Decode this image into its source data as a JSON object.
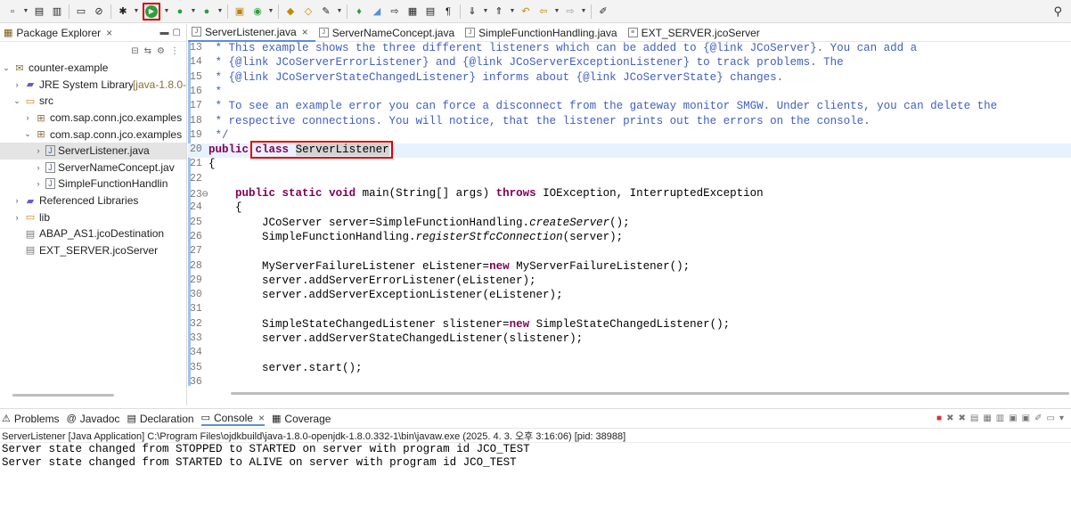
{
  "toolbar": {
    "icons": [
      "new-icon",
      "save-icon",
      "save-all-icon",
      "terminal-icon",
      "skip-breakpoints-icon",
      "debug-icon",
      "run-icon",
      "coverage-icon",
      "external-tools-icon",
      "new-java-project-icon",
      "new-package-icon",
      "new-class-icon",
      "open-type-icon",
      "search-icon",
      "annotation-icon",
      "next-annotation-icon",
      "prev-annotation-icon",
      "back-icon",
      "forward-icon",
      "pin-editor-icon"
    ],
    "highlight_color": "#d00000"
  },
  "package_explorer": {
    "title": "Package Explorer",
    "close": "×",
    "tree": [
      {
        "indent": 0,
        "twisty": "v",
        "icon": "project-icon",
        "label": "counter-example",
        "decor": ""
      },
      {
        "indent": 1,
        "twisty": ">",
        "icon": "library-icon",
        "label": "JRE System Library ",
        "decor": "[java-1.8.0-"
      },
      {
        "indent": 1,
        "twisty": "v",
        "icon": "source-folder-icon",
        "label": "src",
        "decor": ""
      },
      {
        "indent": 2,
        "twisty": ">",
        "icon": "package-icon",
        "label": "com.sap.conn.jco.examples",
        "decor": ""
      },
      {
        "indent": 2,
        "twisty": "v",
        "icon": "package-icon",
        "label": "com.sap.conn.jco.examples",
        "decor": ""
      },
      {
        "indent": 3,
        "twisty": ">",
        "icon": "java-file-icon",
        "label": "ServerListener.java",
        "decor": "",
        "selected": true
      },
      {
        "indent": 3,
        "twisty": ">",
        "icon": "java-file-icon",
        "label": "ServerNameConcept.jav",
        "decor": ""
      },
      {
        "indent": 3,
        "twisty": ">",
        "icon": "java-file-icon",
        "label": "SimpleFunctionHandlin",
        "decor": ""
      },
      {
        "indent": 1,
        "twisty": ">",
        "icon": "library-icon",
        "label": "Referenced Libraries",
        "decor": ""
      },
      {
        "indent": 1,
        "twisty": ">",
        "icon": "folder-icon",
        "label": "lib",
        "decor": ""
      },
      {
        "indent": 1,
        "twisty": "",
        "icon": "file-icon",
        "label": "ABAP_AS1.jcoDestination",
        "decor": ""
      },
      {
        "indent": 1,
        "twisty": "",
        "icon": "file-icon",
        "label": "EXT_SERVER.jcoServer",
        "decor": ""
      }
    ]
  },
  "editor": {
    "tabs": [
      {
        "label": "ServerListener.java",
        "active": true,
        "closable": true,
        "icon": "J"
      },
      {
        "label": "ServerNameConcept.java",
        "active": false,
        "closable": false,
        "icon": "J"
      },
      {
        "label": "SimpleFunctionHandling.java",
        "active": false,
        "closable": false,
        "icon": "J"
      },
      {
        "label": "EXT_SERVER.jcoServer",
        "active": false,
        "closable": false,
        "icon": "≡"
      }
    ],
    "highlight_color": "#e00000",
    "current_line": 20,
    "lines": [
      {
        "n": "13",
        "tokens": [
          {
            "t": " * This example shows the three different listeners which can be added to {@link JCoServer}. You can add a",
            "c": "c"
          }
        ]
      },
      {
        "n": "14",
        "tokens": [
          {
            "t": " * {@link JCoServerErrorListener} and {@link JCoServerExceptionListener} to track problems. The",
            "c": "c"
          }
        ]
      },
      {
        "n": "15",
        "tokens": [
          {
            "t": " * {@link JCoServerStateChangedListener} informs about {@link JCoServerState} changes.",
            "c": "c"
          }
        ]
      },
      {
        "n": "16",
        "tokens": [
          {
            "t": " *",
            "c": "c"
          }
        ]
      },
      {
        "n": "17",
        "tokens": [
          {
            "t": " * To see an example error you can force a disconnect from the gateway monitor SMGW. Under clients, you can delete the",
            "c": "c"
          }
        ]
      },
      {
        "n": "18",
        "tokens": [
          {
            "t": " * respective connections. You will notice, that the listener prints out the errors on the console.",
            "c": "c"
          }
        ]
      },
      {
        "n": "19",
        "tokens": [
          {
            "t": " */",
            "c": "c"
          }
        ]
      },
      {
        "n": "20",
        "tokens": [
          {
            "t": "public",
            "c": "k"
          },
          {
            "t": " ",
            "c": ""
          },
          {
            "t": "class",
            "c": "k"
          },
          {
            "t": " ",
            "c": ""
          },
          {
            "t": "ServerListener",
            "c": "m"
          }
        ]
      },
      {
        "n": "21",
        "tokens": [
          {
            "t": "{",
            "c": ""
          }
        ]
      },
      {
        "n": "22",
        "tokens": []
      },
      {
        "n": "23⊖",
        "tokens": [
          {
            "t": "    ",
            "c": ""
          },
          {
            "t": "public",
            "c": "k"
          },
          {
            "t": " ",
            "c": ""
          },
          {
            "t": "static",
            "c": "k"
          },
          {
            "t": " ",
            "c": ""
          },
          {
            "t": "void",
            "c": "k"
          },
          {
            "t": " main(String[] args) ",
            "c": ""
          },
          {
            "t": "throws",
            "c": "k"
          },
          {
            "t": " IOException, InterruptedException",
            "c": ""
          }
        ]
      },
      {
        "n": "24",
        "tokens": [
          {
            "t": "    {",
            "c": ""
          }
        ]
      },
      {
        "n": "25",
        "tokens": [
          {
            "t": "        JCoServer server=SimpleFunctionHandling.",
            "c": ""
          },
          {
            "t": "createServer",
            "c": "i"
          },
          {
            "t": "();",
            "c": ""
          }
        ]
      },
      {
        "n": "26",
        "tokens": [
          {
            "t": "        SimpleFunctionHandling.",
            "c": ""
          },
          {
            "t": "registerStfcConnection",
            "c": "i"
          },
          {
            "t": "(server);",
            "c": ""
          }
        ]
      },
      {
        "n": "27",
        "tokens": []
      },
      {
        "n": "28",
        "tokens": [
          {
            "t": "        MyServerFailureListener eListener=",
            "c": ""
          },
          {
            "t": "new",
            "c": "k"
          },
          {
            "t": " MyServerFailureListener();",
            "c": ""
          }
        ]
      },
      {
        "n": "29",
        "tokens": [
          {
            "t": "        server.addServerErrorListener(eListener);",
            "c": ""
          }
        ]
      },
      {
        "n": "30",
        "tokens": [
          {
            "t": "        server.addServerExceptionListener(eListener);",
            "c": ""
          }
        ]
      },
      {
        "n": "31",
        "tokens": []
      },
      {
        "n": "32",
        "tokens": [
          {
            "t": "        SimpleStateChangedListener slistener=",
            "c": ""
          },
          {
            "t": "new",
            "c": "k"
          },
          {
            "t": " SimpleStateChangedListener();",
            "c": ""
          }
        ]
      },
      {
        "n": "33",
        "tokens": [
          {
            "t": "        server.addServerStateChangedListener(slistener);",
            "c": ""
          }
        ]
      },
      {
        "n": "34",
        "tokens": []
      },
      {
        "n": "35",
        "tokens": [
          {
            "t": "        server.start();",
            "c": ""
          }
        ]
      },
      {
        "n": "36",
        "tokens": []
      }
    ]
  },
  "console": {
    "tabs": [
      {
        "label": "Problems",
        "icon": "problems-icon",
        "glyph": "⚠"
      },
      {
        "label": "Javadoc",
        "icon": "javadoc-icon",
        "glyph": "@"
      },
      {
        "label": "Declaration",
        "icon": "declaration-icon",
        "glyph": "▤"
      },
      {
        "label": "Console",
        "icon": "console-icon",
        "glyph": "▭",
        "active": true,
        "closable": true
      },
      {
        "label": "Coverage",
        "icon": "coverage-tab-icon",
        "glyph": "▦"
      }
    ],
    "info": "ServerListener [Java Application] C:\\Program Files\\ojdkbuild\\java-1.8.0-openjdk-1.8.0.332-1\\bin\\javaw.exe  (2025. 4. 3. 오후 3:16:06) [pid: 38988]",
    "output": [
      "Server state changed from STOPPED to STARTED on server with program id JCO_TEST",
      "Server state changed from STARTED to ALIVE on server with program id JCO_TEST"
    ]
  }
}
